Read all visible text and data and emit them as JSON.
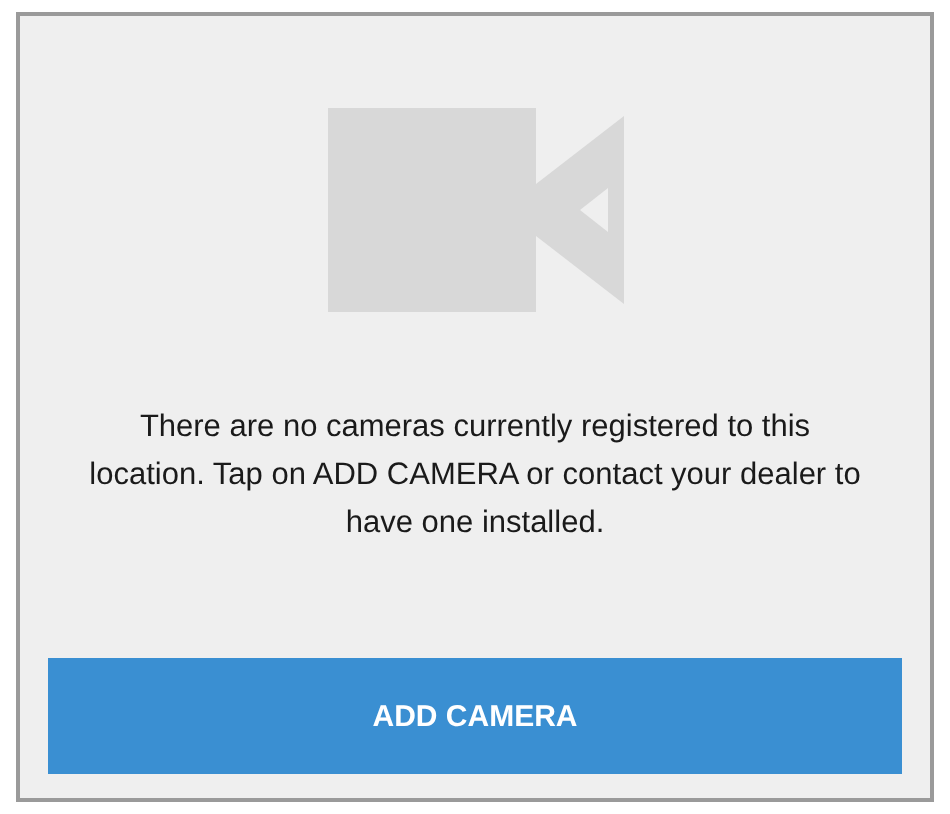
{
  "message": "There are no cameras currently registered to this location. Tap on ADD CAMERA or contact your dealer to have one installed.",
  "button": {
    "label": "ADD CAMERA"
  }
}
